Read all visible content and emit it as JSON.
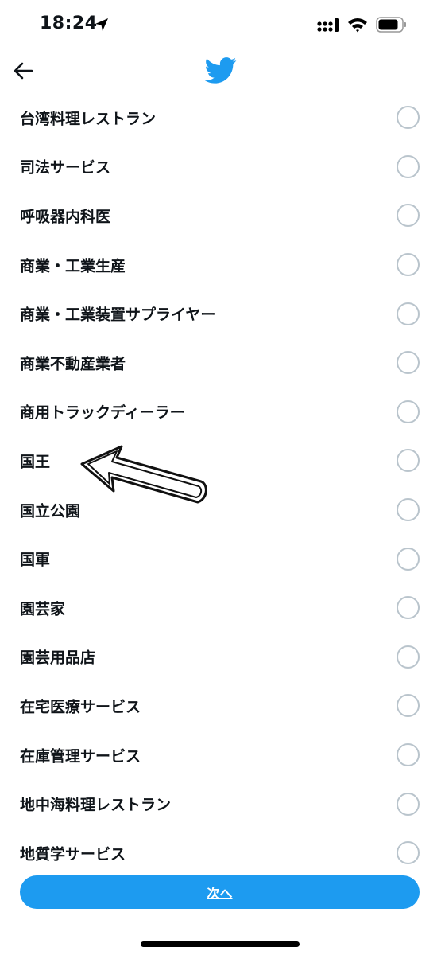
{
  "status_bar": {
    "time": "18:24",
    "icons": [
      "location-arrow-icon",
      "cellular-signal-icon",
      "wifi-icon",
      "battery-icon"
    ]
  },
  "nav": {
    "back_icon": "arrow-left-icon",
    "logo": "twitter-bird-logo"
  },
  "categories": [
    "台湾料理レストラン",
    "司法サービス",
    "呼吸器内科医",
    "商業・工業生産",
    "商業・工業装置サプライヤー",
    "商業不動産業者",
    "商用トラックディーラー",
    "国王",
    "国立公園",
    "国軍",
    "園芸家",
    "園芸用品店",
    "在宅医療サービス",
    "在庫管理サービス",
    "地中海料理レストラン",
    "地質学サービス"
  ],
  "annotation": "hand-drawn-arrow-pointing-left",
  "next_button_label": "次へ",
  "colors": {
    "accent": "#1d9bf0",
    "radio_border": "#b9c4cc",
    "text": "#0f1419"
  }
}
